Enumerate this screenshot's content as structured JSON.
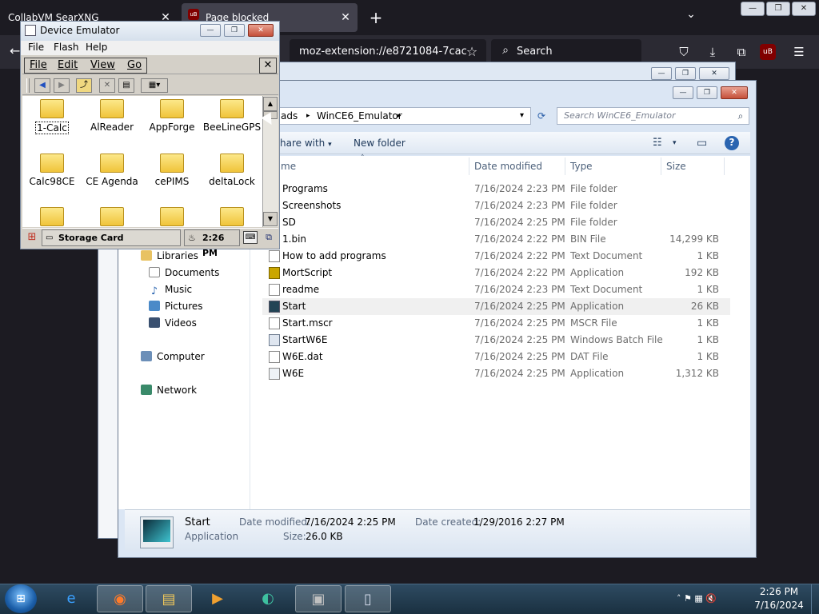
{
  "firefox": {
    "tabs": [
      {
        "label": "CollabVM SearXNG",
        "close": "✕"
      },
      {
        "label": "Page blocked",
        "close": "✕",
        "badge": "uB"
      }
    ],
    "new_tab": "+",
    "tab_list": "⌄",
    "url": "moz-extension://e8721084-7cac",
    "star": "☆",
    "search_placeholder": "Search",
    "search_icon": "⌕",
    "window_buttons": [
      "—",
      "❐",
      "✕"
    ],
    "tools": [
      {
        "name": "pocket-icon",
        "glyph": "⛉"
      },
      {
        "name": "download-icon",
        "glyph": "⤓"
      },
      {
        "name": "extensions-icon",
        "glyph": "⧉"
      },
      {
        "name": "ublock-icon",
        "glyph": "uB"
      },
      {
        "name": "menu-icon",
        "glyph": "☰"
      }
    ]
  },
  "explorer_back": {
    "window_buttons": [
      "—",
      "❐",
      "✕"
    ]
  },
  "explorer": {
    "window_buttons": [
      "—",
      "❐",
      "✕"
    ],
    "address": [
      "ads",
      "WinCE6_Emulator"
    ],
    "address_sep": "▸",
    "address_dropdown": "▾",
    "refresh": "⟳",
    "search_placeholder": "Search WinCE6_Emulator",
    "search_icon": "⌕",
    "toolbar": {
      "share": "hare with",
      "share_arrow": "▾",
      "new_folder": "New folder",
      "views_icon": "☷",
      "views_arrow": "▾",
      "preview_icon": "▭",
      "help_icon": "?"
    },
    "columns": {
      "name": "me",
      "sort": "˄",
      "date": "Date modified",
      "type": "Type",
      "size": "Size"
    },
    "nav": {
      "libraries": "Libraries",
      "documents": "Documents",
      "music": "Music",
      "pictures": "Pictures",
      "videos": "Videos",
      "computer": "Computer",
      "network": "Network"
    },
    "files": [
      {
        "name": "Programs",
        "date": "7/16/2024 2:23 PM",
        "type": "File folder",
        "size": "",
        "icon": "folder"
      },
      {
        "name": "Screenshots",
        "date": "7/16/2024 2:23 PM",
        "type": "File folder",
        "size": "",
        "icon": "folder"
      },
      {
        "name": "SD",
        "date": "7/16/2024 2:25 PM",
        "type": "File folder",
        "size": "",
        "icon": "folder"
      },
      {
        "name": "1.bin",
        "date": "7/16/2024 2:22 PM",
        "type": "BIN File",
        "size": "14,299 KB",
        "icon": "bin"
      },
      {
        "name": "How to add programs",
        "date": "7/16/2024 2:22 PM",
        "type": "Text Document",
        "size": "1 KB",
        "icon": "doc"
      },
      {
        "name": "MortScript",
        "date": "7/16/2024 2:22 PM",
        "type": "Application",
        "size": "192 KB",
        "icon": "mort"
      },
      {
        "name": "readme",
        "date": "7/16/2024 2:23 PM",
        "type": "Text Document",
        "size": "1 KB",
        "icon": "doc"
      },
      {
        "name": "Start",
        "date": "7/16/2024 2:25 PM",
        "type": "Application",
        "size": "26 KB",
        "icon": "app"
      },
      {
        "name": "Start.mscr",
        "date": "7/16/2024 2:25 PM",
        "type": "MSCR File",
        "size": "1 KB",
        "icon": "doc"
      },
      {
        "name": "StartW6E",
        "date": "7/16/2024 2:25 PM",
        "type": "Windows Batch File",
        "size": "1 KB",
        "icon": "bat"
      },
      {
        "name": "W6E.dat",
        "date": "7/16/2024 2:25 PM",
        "type": "DAT File",
        "size": "1 KB",
        "icon": "doc"
      },
      {
        "name": "W6E",
        "date": "7/16/2024 2:25 PM",
        "type": "Application",
        "size": "1,312 KB",
        "icon": "bin"
      }
    ],
    "details": {
      "name": "Start",
      "kind": "Application",
      "modified_label": "Date modified:",
      "modified": "7/16/2024 2:25 PM",
      "created_label": "Date created:",
      "created": "1/29/2016 2:27 PM",
      "size_label": "Size:",
      "size": "26.0 KB"
    }
  },
  "emulator": {
    "title": "Device Emulator",
    "window_buttons": [
      "—",
      "❐",
      "✕"
    ],
    "menu": [
      "File",
      "Flash",
      "Help"
    ],
    "ce_menu": [
      "File",
      "Edit",
      "View",
      "Go"
    ],
    "ce_close": "✕",
    "ce_toolbar": [
      {
        "name": "back-icon",
        "glyph": "◀"
      },
      {
        "name": "forward-icon",
        "glyph": "▶"
      },
      {
        "name": "up-folder-icon",
        "glyph": "⤴"
      },
      {
        "name": "delete-icon",
        "glyph": "✕"
      },
      {
        "name": "properties-icon",
        "glyph": "▤"
      },
      {
        "name": "view-menu-icon",
        "glyph": "▦▾"
      }
    ],
    "items": [
      "1-Calc",
      "AlReader",
      "AppForge",
      "BeeLineGPS",
      "Calc98CE",
      "CE Agenda",
      "cePIMS",
      "deltaLock",
      "",
      "",
      "",
      ""
    ],
    "scroll_up": "▲",
    "scroll_down": "▼",
    "start_icon": "⊞",
    "task_label": "Storage Card",
    "clock": "2:26 PM",
    "keyboard_icon": "⌨",
    "desktop_icon": "⧉"
  },
  "taskbar": {
    "start_glyph": "⊞",
    "apps": [
      {
        "name": "ie-taskbar-icon",
        "glyph": "e",
        "color": "#3aa0ff",
        "active": false
      },
      {
        "name": "firefox-taskbar-icon",
        "glyph": "◉",
        "color": "#ff7b2a",
        "active": true
      },
      {
        "name": "explorer-taskbar-icon",
        "glyph": "▤",
        "color": "#f0c85a",
        "active": true
      },
      {
        "name": "media-player-taskbar-icon",
        "glyph": "▶",
        "color": "#f0a030",
        "active": false
      },
      {
        "name": "app-taskbar-icon",
        "glyph": "◐",
        "color": "#3ec0a0",
        "active": false
      },
      {
        "name": "remote-taskbar-icon",
        "glyph": "▣",
        "color": "#c0c0c0",
        "active": true
      },
      {
        "name": "emulator-taskbar-icon",
        "glyph": "▯",
        "color": "#d0d8e8",
        "active": true
      }
    ],
    "tray": "˄  ⚑  ▦  🔇",
    "time": "2:26 PM",
    "date": "7/16/2024"
  }
}
